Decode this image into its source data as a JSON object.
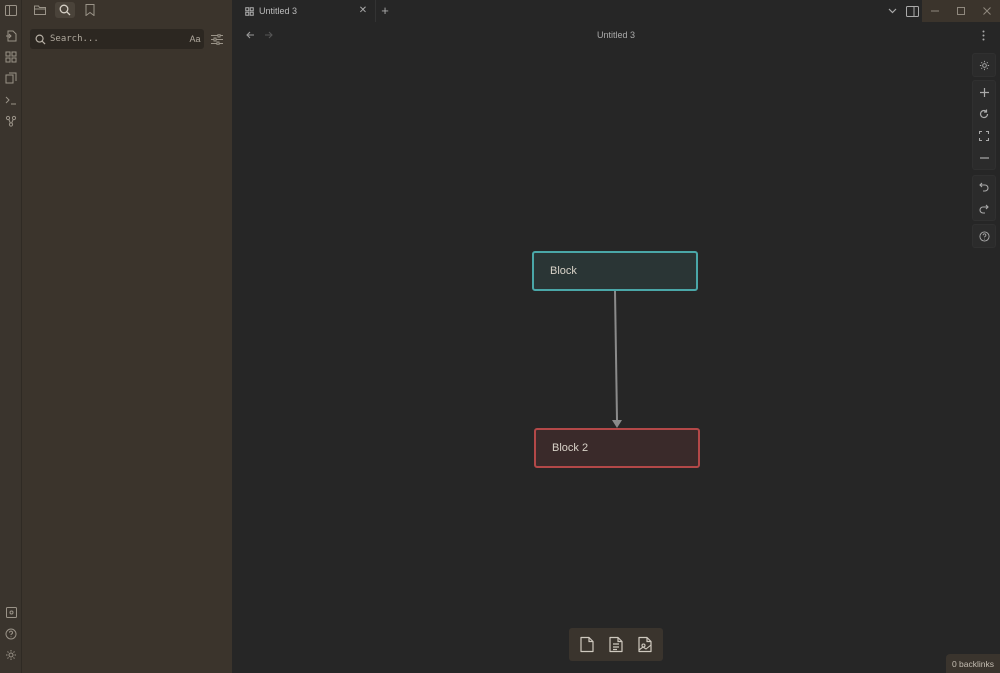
{
  "ribbon": {
    "items": [
      {
        "icon": "open-quick-switcher-icon"
      },
      {
        "icon": "canvas-icon"
      },
      {
        "icon": "daily-notes-icon"
      },
      {
        "icon": "command-palette-icon"
      },
      {
        "icon": "graph-icon"
      }
    ],
    "bottom": [
      {
        "icon": "vault-icon"
      },
      {
        "icon": "help-icon"
      },
      {
        "icon": "settings-icon"
      }
    ]
  },
  "sidebar": {
    "tabs": [
      {
        "name": "file-explorer",
        "active": false
      },
      {
        "name": "search",
        "active": true
      },
      {
        "name": "bookmarks",
        "active": false
      }
    ],
    "search": {
      "placeholder": "Search...",
      "value": "",
      "match_case_label": "Aa"
    }
  },
  "tabs": [
    {
      "label": "Untitled 3",
      "active": true
    }
  ],
  "nav": {
    "title": "Untitled 3"
  },
  "canvas": {
    "nodes": [
      {
        "id": "n1",
        "label": "Block",
        "color": "#4aa7a8"
      },
      {
        "id": "n2",
        "label": "Block 2",
        "color": "#b34848"
      }
    ],
    "edges": [
      {
        "from": "n1",
        "to": "n2"
      }
    ],
    "controls": [
      "settings",
      "zoom-in",
      "reset-zoom",
      "zoom-to-fit",
      "zoom-out",
      "undo",
      "redo",
      "help"
    ]
  },
  "bottom_toolbar": [
    "add-card",
    "add-note",
    "add-media"
  ],
  "status": {
    "backlinks": "0 backlinks"
  },
  "colors": {
    "accent_teal": "#4aa7a8",
    "accent_red": "#b34848",
    "sidebar_bg": "#3b342c",
    "canvas_bg": "#262626"
  }
}
